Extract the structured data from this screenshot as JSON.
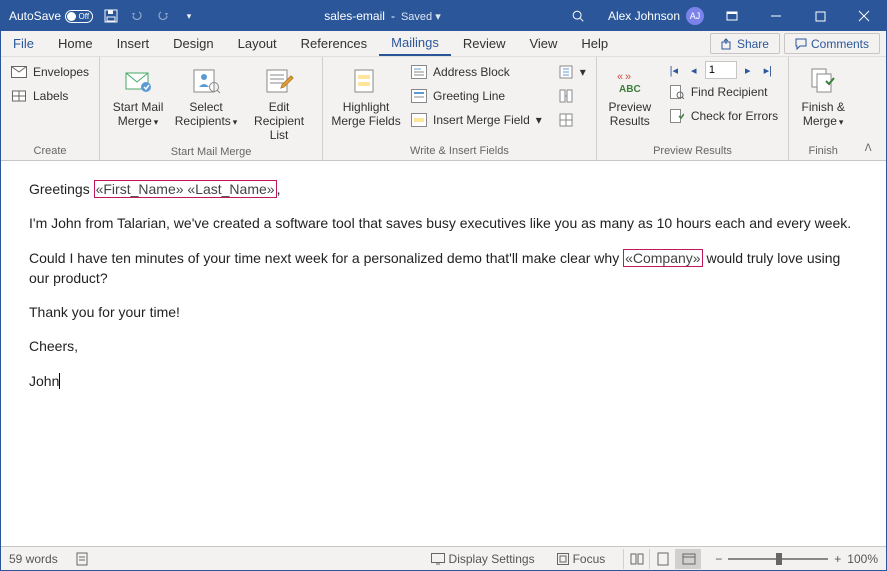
{
  "titlebar": {
    "autosave_label": "AutoSave",
    "autosave_state": "Off",
    "doc_name": "sales-email",
    "saved_label": "Saved",
    "dropdown_glyph": "▾",
    "user_name": "Alex Johnson",
    "user_initials": "AJ"
  },
  "tabs": {
    "file": "File",
    "home": "Home",
    "insert": "Insert",
    "design": "Design",
    "layout": "Layout",
    "references": "References",
    "mailings": "Mailings",
    "review": "Review",
    "view": "View",
    "help": "Help",
    "share": "Share",
    "comments": "Comments"
  },
  "ribbon": {
    "create": {
      "envelopes": "Envelopes",
      "labels": "Labels",
      "group": "Create"
    },
    "startmm": {
      "start_mail_merge": "Start Mail",
      "start_mail_merge2": "Merge",
      "select_recipients": "Select",
      "select_recipients2": "Recipients",
      "edit_recipient_list": "Edit",
      "edit_recipient_list2": "Recipient List",
      "group": "Start Mail Merge"
    },
    "write": {
      "highlight": "Highlight",
      "highlight2": "Merge Fields",
      "address_block": "Address Block",
      "greeting_line": "Greeting Line",
      "insert_merge_field": "Insert Merge Field",
      "group": "Write & Insert Fields"
    },
    "preview": {
      "preview_results": "Preview",
      "preview_results2": "Results",
      "nav_value": "1",
      "find_recipient": "Find Recipient",
      "check_errors": "Check for Errors",
      "group": "Preview Results"
    },
    "finish": {
      "finish": "Finish &",
      "finish2": "Merge",
      "group": "Finish"
    }
  },
  "document": {
    "p1_a": "Greetings ",
    "p1_field": "«First_Name» «Last_Name»",
    "p1_b": ",",
    "p2": "I'm John from Talarian, we've created a software tool that saves busy executives like you as many as 10 hours each and every week.",
    "p3_a": "Could I have ten minutes of your time next week for a personalized demo that'll make clear why ",
    "p3_field": "«Company»",
    "p3_b": " would truly love using our product?",
    "p4": "Thank you for your time!",
    "p5": "Cheers,",
    "p6": "John"
  },
  "statusbar": {
    "words": "59 words",
    "display_settings": "Display Settings",
    "focus": "Focus",
    "zoom_pct": "100%"
  }
}
